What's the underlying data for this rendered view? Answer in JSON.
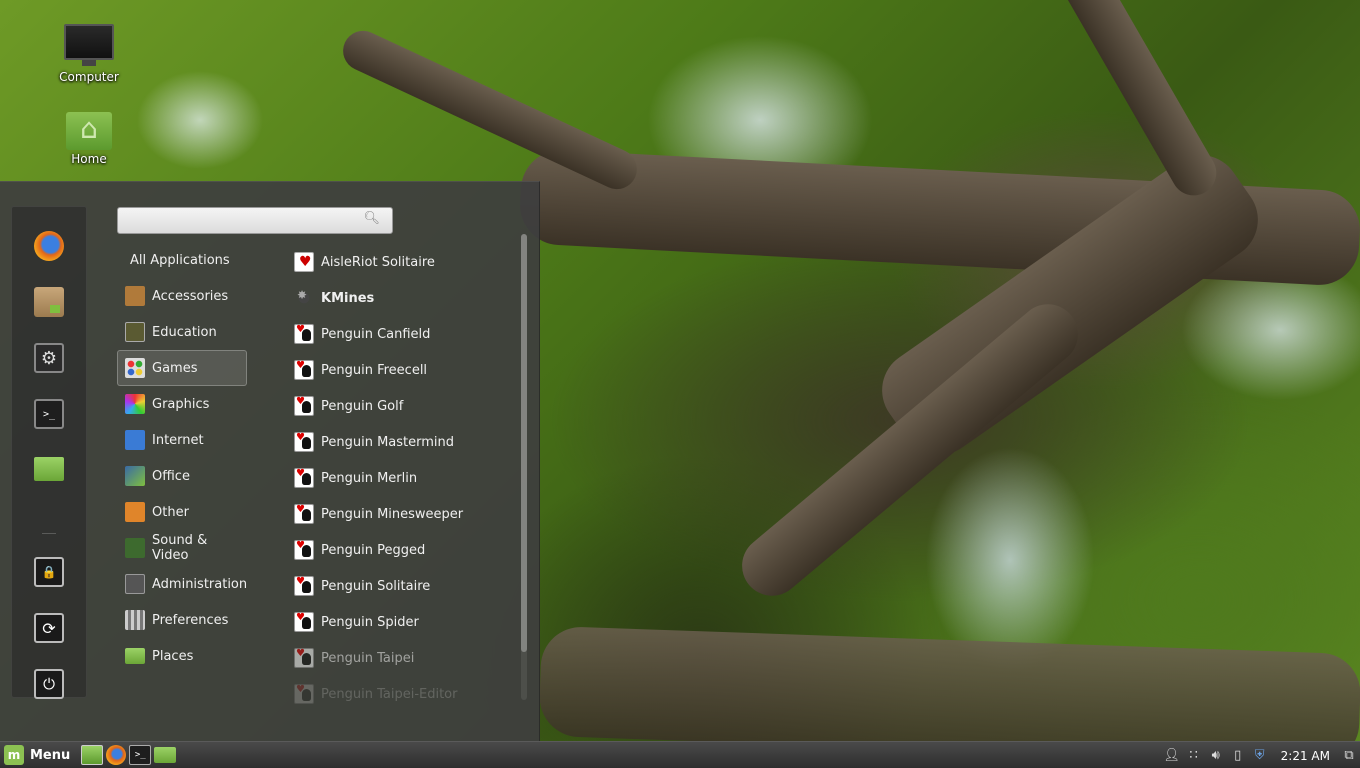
{
  "desktop": {
    "icons": [
      {
        "label": "Computer",
        "icon": "computer-icon"
      },
      {
        "label": "Home",
        "icon": "home-folder-icon"
      }
    ]
  },
  "menu": {
    "search": {
      "placeholder": "",
      "value": ""
    },
    "favorites": [
      {
        "name": "firefox-icon"
      },
      {
        "name": "software-manager-icon"
      },
      {
        "name": "system-settings-icon"
      },
      {
        "name": "terminal-icon"
      },
      {
        "name": "files-icon"
      },
      {
        "name": "lock-screen-icon"
      },
      {
        "name": "logout-icon"
      },
      {
        "name": "shutdown-icon"
      }
    ],
    "categories": [
      {
        "label": "All Applications"
      },
      {
        "label": "Accessories",
        "color": "#b07a3a"
      },
      {
        "label": "Education",
        "color": "#6a6a3a"
      },
      {
        "label": "Games",
        "color": "#bdbdbd",
        "active": true
      },
      {
        "label": "Graphics",
        "color": "#e04a9a"
      },
      {
        "label": "Internet",
        "color": "#3a7bd5"
      },
      {
        "label": "Office",
        "color": "#3a6aa5"
      },
      {
        "label": "Other",
        "color": "#e0852a"
      },
      {
        "label": "Sound & Video",
        "color": "#4a8a3a"
      },
      {
        "label": "Administration",
        "color": "#777777"
      },
      {
        "label": "Preferences",
        "color": "#999999"
      },
      {
        "label": "Places",
        "color": "#7fbf3f"
      }
    ],
    "apps": [
      {
        "label": "AisleRiot Solitaire",
        "icon": "cards"
      },
      {
        "label": "KMines",
        "icon": "mine"
      },
      {
        "label": "Penguin Canfield",
        "icon": "penguin"
      },
      {
        "label": "Penguin Freecell",
        "icon": "penguin"
      },
      {
        "label": "Penguin Golf",
        "icon": "penguin"
      },
      {
        "label": "Penguin Mastermind",
        "icon": "penguin"
      },
      {
        "label": "Penguin Merlin",
        "icon": "penguin"
      },
      {
        "label": "Penguin Minesweeper",
        "icon": "penguin"
      },
      {
        "label": "Penguin Pegged",
        "icon": "penguin"
      },
      {
        "label": "Penguin Solitaire",
        "icon": "penguin"
      },
      {
        "label": "Penguin Spider",
        "icon": "penguin"
      },
      {
        "label": "Penguin Taipei",
        "icon": "penguin"
      },
      {
        "label": "Penguin Taipei-Editor",
        "icon": "penguin"
      }
    ]
  },
  "taskbar": {
    "menu_label": "Menu",
    "launchers": [
      "show-desktop-icon",
      "firefox-icon",
      "terminal-icon",
      "files-icon"
    ],
    "tray": [
      "user-icon",
      "wifi-icon",
      "volume-icon",
      "battery-icon",
      "update-shield-icon",
      "workspace-icon"
    ],
    "clock": "2:21 AM"
  }
}
